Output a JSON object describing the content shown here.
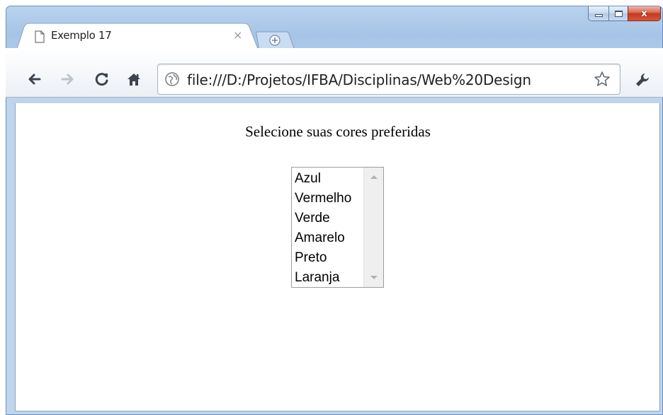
{
  "window": {
    "controls": {
      "minimize_icon": "minimize-icon",
      "maximize_icon": "maximize-icon",
      "close_icon": "close-icon",
      "close_glyph": "x"
    }
  },
  "tabs": [
    {
      "title": "Exemplo 17",
      "close_glyph": "×",
      "active": true
    }
  ],
  "toolbar": {
    "icons": [
      "back-arrow-icon",
      "forward-arrow-icon",
      "reload-icon",
      "home-icon",
      "globe-icon",
      "bookmark-star-icon",
      "wrench-icon"
    ],
    "address": "file:///D:/Projetos/IFBA/Disciplinas/Web%20Design"
  },
  "page": {
    "heading": "Selecione suas cores preferidas",
    "color_list": {
      "options": [
        "Azul",
        "Vermelho",
        "Verde",
        "Amarelo",
        "Preto",
        "Laranja"
      ]
    }
  },
  "colors": {
    "frame_blue": "#a6c4e6",
    "close_red": "#c23a20"
  }
}
